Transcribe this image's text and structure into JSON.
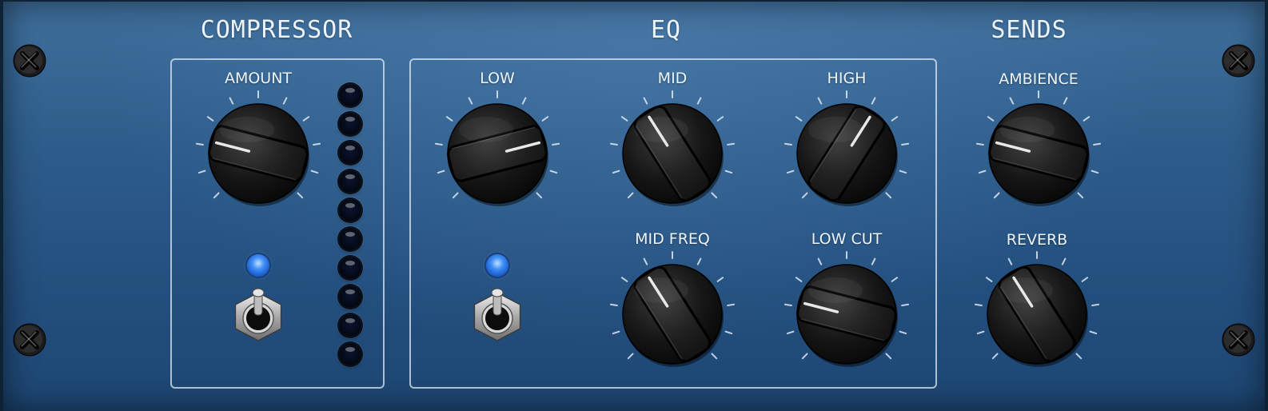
{
  "sections": {
    "compressor": {
      "title": "COMPRESSOR"
    },
    "eq": {
      "title": "EQ"
    },
    "sends": {
      "title": "SENDS"
    }
  },
  "knobs": [
    {
      "id": "amount",
      "label": "AMOUNT",
      "value": 0.22
    },
    {
      "id": "low",
      "label": "LOW",
      "value": 0.78
    },
    {
      "id": "mid",
      "label": "MID",
      "value": 0.38
    },
    {
      "id": "high",
      "label": "HIGH",
      "value": 0.62
    },
    {
      "id": "mid-freq",
      "label": "MID FREQ",
      "value": 0.38
    },
    {
      "id": "low-cut",
      "label": "LOW CUT",
      "value": 0.22
    },
    {
      "id": "ambience",
      "label": "AMBIENCE",
      "value": 0.22
    },
    {
      "id": "reverb",
      "label": "REVERB",
      "value": 0.38
    }
  ],
  "compressor": {
    "meter_segments": 10,
    "meter_level": 0,
    "led_on": true,
    "switch": "on"
  },
  "eq": {
    "led_on": true,
    "switch": "on"
  },
  "colors": {
    "panel": "#2e5d8b",
    "label": "#eef4fb",
    "led_blue": "#3f8ef5",
    "knob": "#141414"
  }
}
